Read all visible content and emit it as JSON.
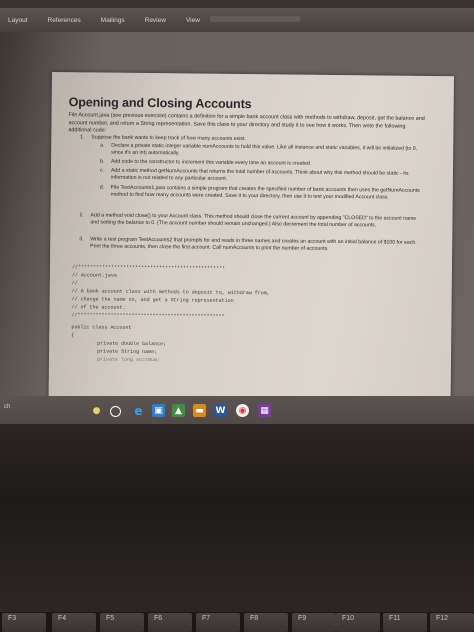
{
  "ribbon": {
    "tabs": [
      "Layout",
      "References",
      "Mailings",
      "Review",
      "View"
    ]
  },
  "document": {
    "title": "Opening and Closing Accounts",
    "intro": "File Account.java (see previous exercise) contains a definition for a simple bank account class with methods to withdraw, deposit, get the balance and account number, and return a String representation. Save this class to your directory and study it to see how it works. Then write the following additional code:",
    "items": [
      {
        "num": "1.",
        "text": "Suppose the bank wants to keep track of how many accounts exist."
      },
      {
        "num": "a.",
        "text": "Declare a private static integer variable numAccounts to hold this value. Like all instance and static variables, it will be initialized (to 0, since it's an int) automatically."
      },
      {
        "num": "b.",
        "text": "Add code to the constructor to increment this variable every time an account is created."
      },
      {
        "num": "c.",
        "text": "Add a static method getNumAccounts that returns the total number of accounts. Think about why this method should be static - its information is not related to any particular account."
      },
      {
        "num": "d.",
        "text": "File TestAccounts1.java contains a simple program that creates the specified number of bank accounts then uses the getNumAccounts method to find how many accounts were created. Save it to your directory, then use it to test your modified Account class."
      },
      {
        "num": "2.",
        "text": "Add a method void close() to your Account class. This method should close the current account by appending \"CLOSED\" to the account name and setting the balance to 0. (The account number should remain unchanged.) Also decrement the total number of accounts."
      },
      {
        "num": "3.",
        "text": "Write a test program TestAccounts2 that prompts for and reads in three names and creates an account with an initial balance of $100 for each. Print the three accounts, then close the first account. Call numAccounts to print the number of accounts."
      }
    ],
    "code": [
      "//*************************************************",
      "// Account.java",
      "//",
      "// A bank account class with methods to deposit to, withdraw from,",
      "// change the name on, and get a String representation",
      "// of the account.",
      "//*************************************************",
      "public class Account",
      "{",
      "private double balance;",
      "private String name;",
      "private long acctNum;"
    ]
  },
  "taskbar": {
    "side_label": "ch"
  },
  "keyboard": {
    "fkeys": [
      "F3",
      "F4",
      "F5",
      "F6",
      "F7",
      "F8",
      "F9",
      "F10",
      "F11",
      "F12"
    ]
  }
}
